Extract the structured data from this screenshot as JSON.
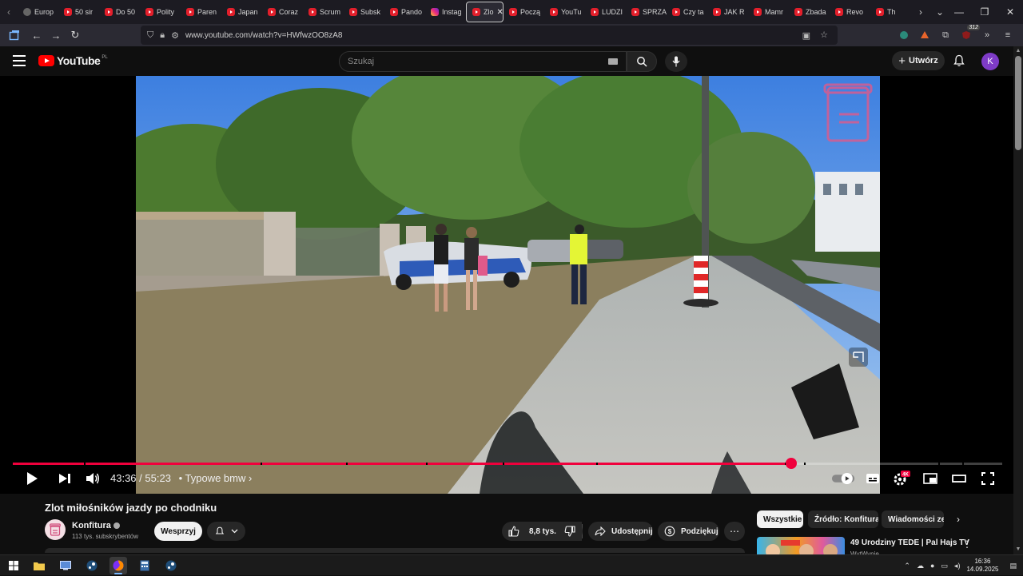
{
  "browser": {
    "tabs": [
      {
        "label": "Europ",
        "icon": "globe-icon",
        "active": false
      },
      {
        "label": "50 sir",
        "icon": "youtube-icon",
        "active": false
      },
      {
        "label": "Do 50",
        "icon": "youtube-icon",
        "active": false
      },
      {
        "label": "Polity",
        "icon": "youtube-icon",
        "active": false
      },
      {
        "label": "Paren",
        "icon": "youtube-icon",
        "active": false
      },
      {
        "label": "Japan",
        "icon": "youtube-icon",
        "active": false
      },
      {
        "label": "Coraz",
        "icon": "youtube-icon",
        "active": false
      },
      {
        "label": "Scrum",
        "icon": "youtube-icon",
        "active": false
      },
      {
        "label": "Subsk",
        "icon": "youtube-icon",
        "active": false
      },
      {
        "label": "Pando",
        "icon": "youtube-icon",
        "active": false
      },
      {
        "label": "Instag",
        "icon": "instagram-icon",
        "active": false
      },
      {
        "label": "Zlo",
        "icon": "youtube-icon",
        "active": true
      },
      {
        "label": "Począ",
        "icon": "youtube-icon",
        "active": false
      },
      {
        "label": "YouTu",
        "icon": "youtube-icon",
        "active": false
      },
      {
        "label": "LUDZI",
        "icon": "youtube-icon",
        "active": false
      },
      {
        "label": "SPRZA",
        "icon": "youtube-icon",
        "active": false
      },
      {
        "label": "Czy ta",
        "icon": "youtube-icon",
        "active": false
      },
      {
        "label": "JAK R",
        "icon": "youtube-icon",
        "active": false
      },
      {
        "label": "Mamr",
        "icon": "youtube-icon",
        "active": false
      },
      {
        "label": "Zbada",
        "icon": "youtube-icon",
        "active": false
      },
      {
        "label": "Revo",
        "icon": "youtube-icon",
        "active": false
      },
      {
        "label": "Th",
        "icon": "youtube-icon",
        "active": false
      }
    ],
    "url": "www.youtube.com/watch?v=HWfwzOO8zA8",
    "extensions_badge": "312"
  },
  "youtube": {
    "logo_text": "YouTube",
    "region": "PL",
    "search_placeholder": "Szukaj",
    "create_label": "Utwórz",
    "avatar_letter": "K",
    "brand_color": "#ff0000",
    "accent_color": "#f0003c"
  },
  "player": {
    "current_time": "43:36",
    "separator": "/",
    "duration": "55:23",
    "chapter": "• Typowe bmw",
    "progress_fraction": 0.787,
    "chapter_marks": [
      0.072,
      0.25,
      0.337,
      0.418,
      0.495,
      0.59,
      0.78,
      0.8,
      0.935,
      0.96
    ],
    "quality_badge": "4K"
  },
  "video": {
    "title": "Zlot miłośników jazdy po chodniku",
    "channel": "Konfitura",
    "subscribers": "113 tys. subskrybentów",
    "support_label": "Wesprzyj",
    "likes": "8,8 tys.",
    "share_label": "Udostępnij",
    "thanks_label": "Podziękuj"
  },
  "sidebar": {
    "chips": [
      {
        "label": "Wszystkie",
        "active": true
      },
      {
        "label": "Źródło: Konfitura",
        "active": false
      },
      {
        "label": "Wiadomości ze s",
        "active": false
      }
    ],
    "recommendation": {
      "title": "49 Urodziny TEDE | Pal Hajs TV",
      "channel": "WytWynie"
    }
  },
  "taskbar": {
    "time": "16:36",
    "date": "14.09.2025"
  }
}
